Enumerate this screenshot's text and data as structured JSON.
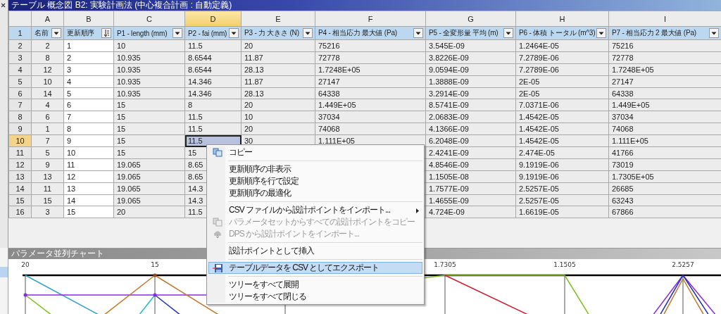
{
  "table_panel": {
    "title": "テーブル 概念図 B2: 実験計画法 (中心複合計画 : 自動定義)"
  },
  "table": {
    "corner_row": "1",
    "columns": [
      {
        "letter": "A",
        "header": "名前",
        "kind": "filter",
        "selected": false,
        "editable": false
      },
      {
        "letter": "B",
        "header": "更新順序",
        "kind": "sort",
        "selected": false,
        "editable": true
      },
      {
        "letter": "C",
        "header": "P1 - length (mm)",
        "kind": "filter",
        "selected": false,
        "editable": false
      },
      {
        "letter": "D",
        "header": "P2 - fai (mm)",
        "kind": "filter",
        "selected": true,
        "editable": false
      },
      {
        "letter": "E",
        "header": "P3 - 力 大きさ (N)",
        "kind": "filter",
        "selected": false,
        "editable": false
      },
      {
        "letter": "F",
        "header": "P4 - 相当応力 最大値 (Pa)",
        "kind": "filter",
        "selected": false,
        "editable": false
      },
      {
        "letter": "G",
        "header": "P5 - 全変形量 平均 (m)",
        "kind": "filter",
        "selected": false,
        "editable": false
      },
      {
        "letter": "H",
        "header": "P6 - 体積 トータル (m^3)",
        "kind": "filter",
        "selected": false,
        "editable": false
      },
      {
        "letter": "I",
        "header": "P7 - 相当応力 2 最大値 (Pa)",
        "kind": "filter",
        "selected": false,
        "editable": false
      }
    ],
    "rows": [
      {
        "number": "2",
        "selected": false,
        "cells": [
          "2",
          "1",
          "10",
          "11.5",
          "20",
          "75216",
          "3.545E-09",
          "1.2464E-05",
          "75216"
        ]
      },
      {
        "number": "3",
        "selected": false,
        "cells": [
          "8",
          "2",
          "10.935",
          "8.6544",
          "11.87",
          "72778",
          "3.8226E-09",
          "7.2789E-06",
          "72778"
        ]
      },
      {
        "number": "4",
        "selected": false,
        "cells": [
          "12",
          "3",
          "10.935",
          "8.6544",
          "28.13",
          "1.7248E+05",
          "9.0594E-09",
          "7.2789E-06",
          "1.7248E+05"
        ]
      },
      {
        "number": "5",
        "selected": false,
        "cells": [
          "10",
          "4",
          "10.935",
          "14.346",
          "11.87",
          "27147",
          "1.3888E-09",
          "2E-05",
          "27147"
        ]
      },
      {
        "number": "6",
        "selected": false,
        "cells": [
          "14",
          "5",
          "10.935",
          "14.346",
          "28.13",
          "64338",
          "3.2914E-09",
          "2E-05",
          "64338"
        ]
      },
      {
        "number": "7",
        "selected": false,
        "cells": [
          "4",
          "6",
          "15",
          "8",
          "20",
          "1.449E+05",
          "8.5741E-09",
          "7.0371E-06",
          "1.449E+05"
        ]
      },
      {
        "number": "8",
        "selected": false,
        "cells": [
          "6",
          "7",
          "15",
          "11.5",
          "10",
          "37034",
          "2.0683E-09",
          "1.4542E-05",
          "37034"
        ]
      },
      {
        "number": "9",
        "selected": false,
        "cells": [
          "1",
          "8",
          "15",
          "11.5",
          "20",
          "74068",
          "4.1366E-09",
          "1.4542E-05",
          "74068"
        ]
      },
      {
        "number": "10",
        "selected": true,
        "cells": [
          "7",
          "9",
          "15",
          "11.5",
          "30",
          "1.111E+05",
          "6.2048E-09",
          "1.4542E-05",
          "1.111E+05"
        ]
      },
      {
        "number": "11",
        "selected": false,
        "cells": [
          "5",
          "10",
          "15",
          "15",
          null,
          null,
          "2.4241E-09",
          "2.474E-05",
          "41766"
        ]
      },
      {
        "number": "12",
        "selected": false,
        "cells": [
          "9",
          "11",
          "19.065",
          "8.65",
          null,
          null,
          "4.8546E-09",
          "9.1919E-06",
          "73019"
        ]
      },
      {
        "number": "13",
        "selected": false,
        "cells": [
          "13",
          "12",
          "19.065",
          "8.65",
          null,
          null,
          "1.1505E-08",
          "9.1919E-06",
          "1.7305E+05"
        ]
      },
      {
        "number": "14",
        "selected": false,
        "cells": [
          "11",
          "13",
          "19.065",
          "14.3",
          null,
          null,
          "1.7577E-09",
          "2.5257E-05",
          "26685"
        ]
      },
      {
        "number": "15",
        "selected": false,
        "cells": [
          "15",
          "14",
          "19.065",
          "14.3",
          null,
          null,
          "1.4655E-09",
          "2.5257E-05",
          "63243"
        ]
      },
      {
        "number": "16",
        "selected": false,
        "cells": [
          "3",
          "15",
          "20",
          "11.5",
          null,
          null,
          "4.724E-09",
          "1.6619E-05",
          "67866"
        ]
      }
    ]
  },
  "chart_panel": {
    "title": "パラメータ並列チャート",
    "axis_labels": [
      "20",
      "15",
      "1.7305",
      "1.1505",
      "2.5257"
    ]
  },
  "context_menu": {
    "items": [
      {
        "kind": "item",
        "label": "コピー",
        "disabled": false,
        "selected": false,
        "submenu": false
      },
      {
        "kind": "separator"
      },
      {
        "kind": "item",
        "label": "更新順序の非表示",
        "disabled": false,
        "selected": false,
        "submenu": false
      },
      {
        "kind": "item",
        "label": "更新順序を行で設定",
        "disabled": false,
        "selected": false,
        "submenu": false
      },
      {
        "kind": "item",
        "label": "更新順序の最適化",
        "disabled": false,
        "selected": false,
        "submenu": false
      },
      {
        "kind": "separator"
      },
      {
        "kind": "item",
        "label": "CSV ファイルから設計ポイントをインポート...",
        "disabled": false,
        "selected": false,
        "submenu": true
      },
      {
        "kind": "item",
        "label": "パラメータセットからすべての設計ポイントをコピー",
        "disabled": true,
        "selected": false,
        "submenu": false
      },
      {
        "kind": "item",
        "label": "DPS から設計ポイントをインポート...",
        "disabled": true,
        "selected": false,
        "submenu": false
      },
      {
        "kind": "separator"
      },
      {
        "kind": "item",
        "label": "設計ポイントとして挿入",
        "disabled": false,
        "selected": false,
        "submenu": false
      },
      {
        "kind": "separator"
      },
      {
        "kind": "item",
        "label": "テーブルデータを CSV としてエクスポート",
        "disabled": false,
        "selected": true,
        "submenu": false
      },
      {
        "kind": "separator"
      },
      {
        "kind": "item",
        "label": "ツリーをすべて展開",
        "disabled": false,
        "selected": false,
        "submenu": false
      },
      {
        "kind": "item",
        "label": "ツリーをすべて閉じる",
        "disabled": false,
        "selected": false,
        "submenu": false
      }
    ]
  }
}
